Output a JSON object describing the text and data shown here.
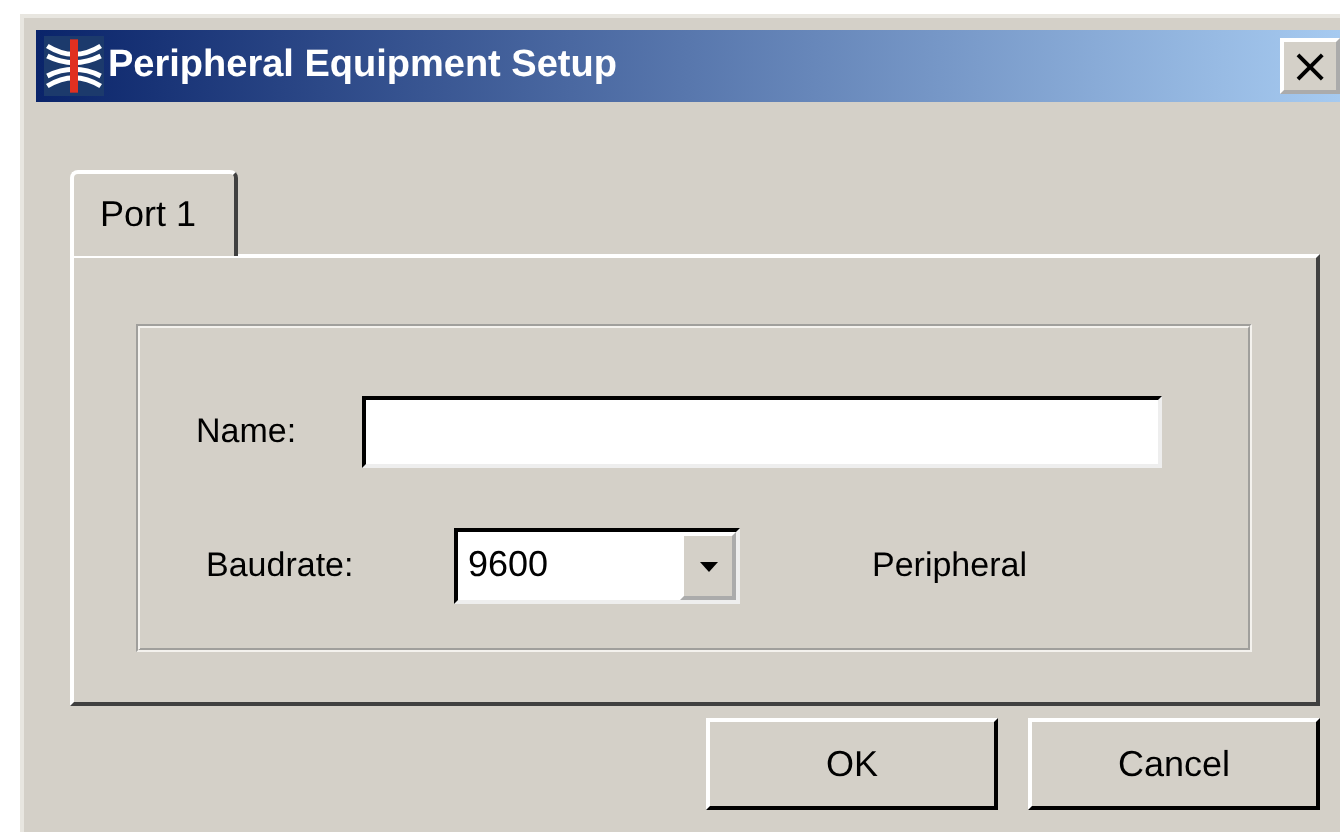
{
  "window": {
    "title": "Peripheral Equipment Setup",
    "close": "×"
  },
  "tabs": [
    {
      "label": "Port 1",
      "selected": true
    }
  ],
  "form": {
    "name_label": "Name:",
    "baud_label": "Baudrate:",
    "baud_value": "9600",
    "note": "Peripheral"
  },
  "buttons": [
    "OK",
    "Cancel"
  ]
}
